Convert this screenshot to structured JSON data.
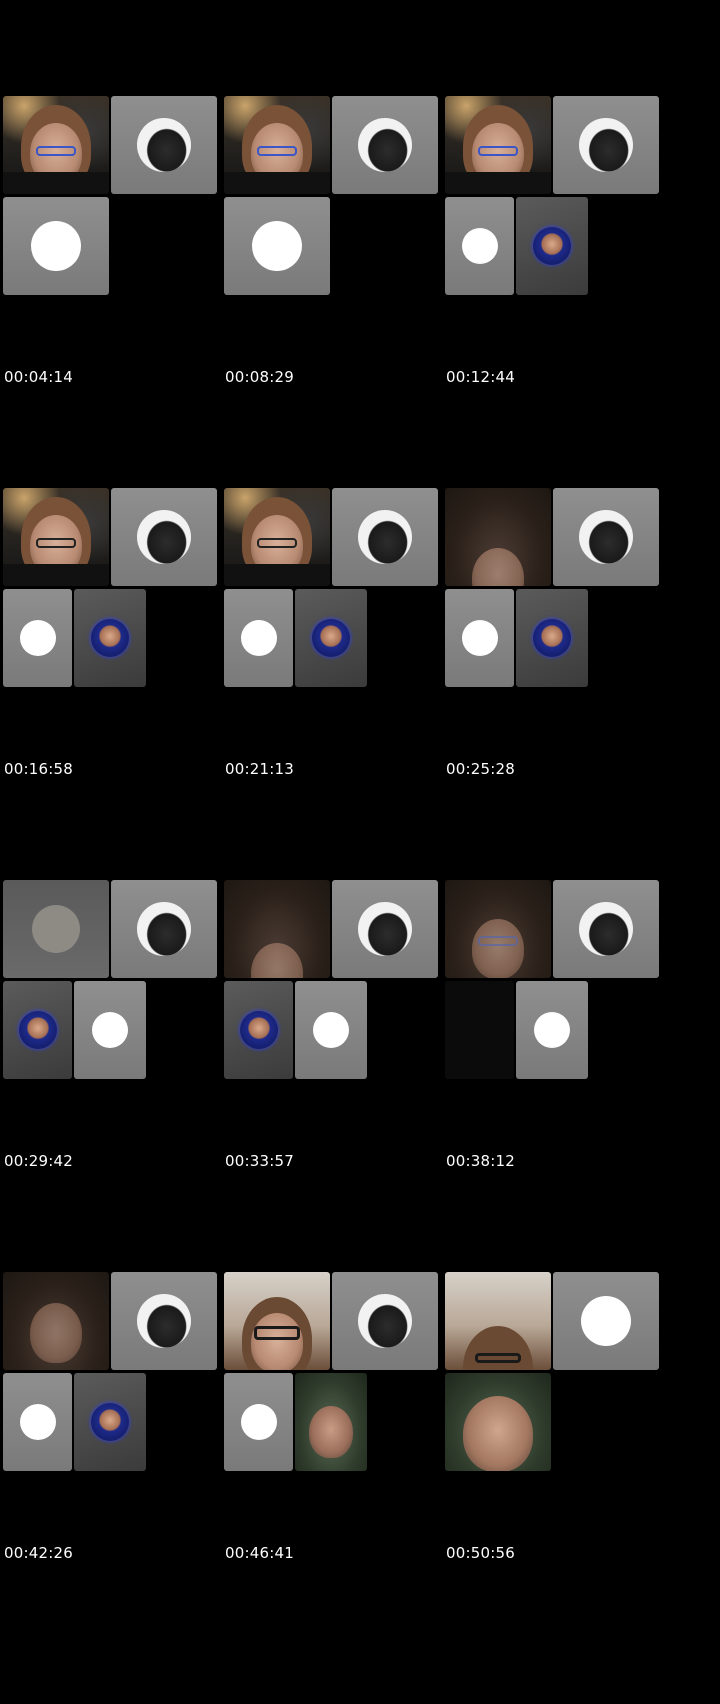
{
  "frames": [
    {
      "timestamp": "00:04:14"
    },
    {
      "timestamp": "00:08:29"
    },
    {
      "timestamp": "00:12:44"
    },
    {
      "timestamp": "00:16:58"
    },
    {
      "timestamp": "00:21:13"
    },
    {
      "timestamp": "00:25:28"
    },
    {
      "timestamp": "00:29:42"
    },
    {
      "timestamp": "00:33:57"
    },
    {
      "timestamp": "00:38:12"
    },
    {
      "timestamp": "00:42:26"
    },
    {
      "timestamp": "00:46:41"
    },
    {
      "timestamp": "00:50:56"
    }
  ]
}
